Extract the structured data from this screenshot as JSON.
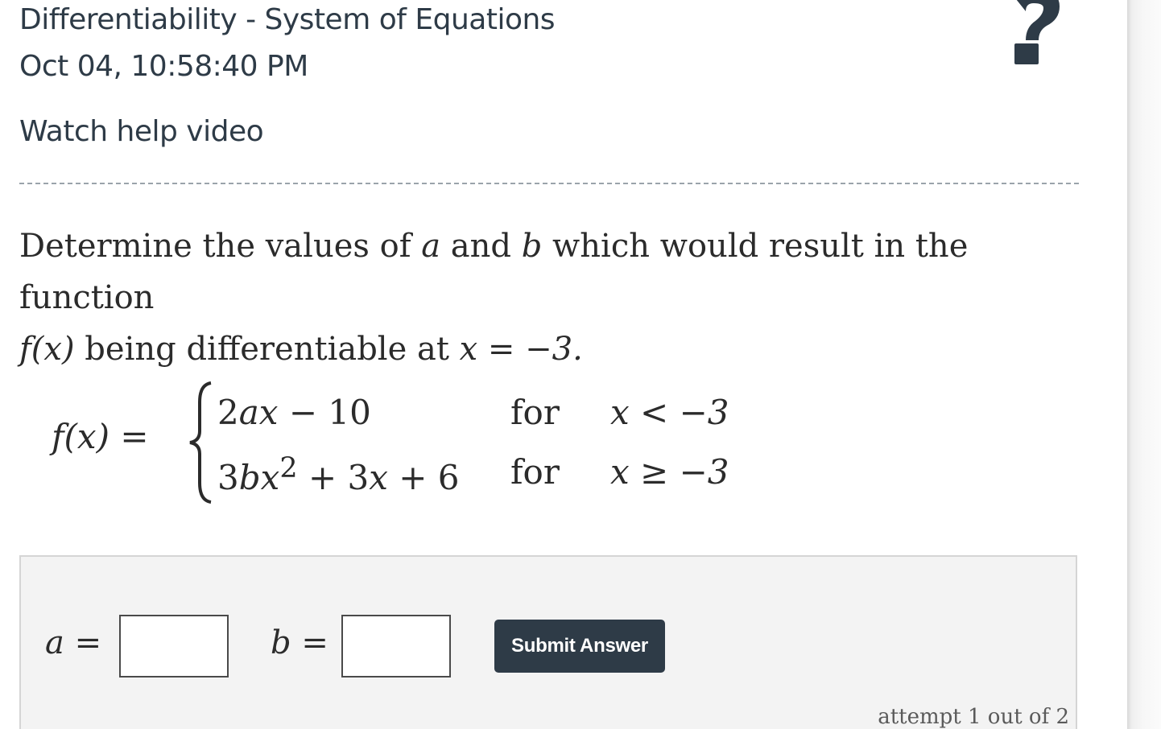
{
  "header": {
    "title": "Differentiability - System of Equations",
    "timestamp": "Oct 04, 10:58:40 PM",
    "help_link": "Watch help video",
    "help_icon": "question-mark-icon"
  },
  "question": {
    "text_part1": "Determine the values of ",
    "var_a": "a",
    "text_and": " and ",
    "var_b": "b",
    "text_part2": " which would result in the function",
    "func": "f(x)",
    "text_part3": " being differentiable at ",
    "condition": "x = −3."
  },
  "piecewise": {
    "lhs": "f(x) =",
    "pieces": [
      {
        "expr_html": "2<i>ax</i> − 10",
        "word": "for",
        "cond": "x < −3"
      },
      {
        "expr_html": "3<i>bx</i><sup>2</sup> + 3<i>x</i> + 6",
        "word": "for",
        "cond": "x ≥ −3"
      }
    ]
  },
  "answer": {
    "a_label": "a =",
    "b_label": "b =",
    "a_value": "",
    "b_value": "",
    "submit_label": "Submit Answer",
    "attempt_text": "attempt 1 out of 2"
  },
  "colors": {
    "brand_dark": "#2e3b47",
    "panel_bg": "#f3f3f3"
  }
}
